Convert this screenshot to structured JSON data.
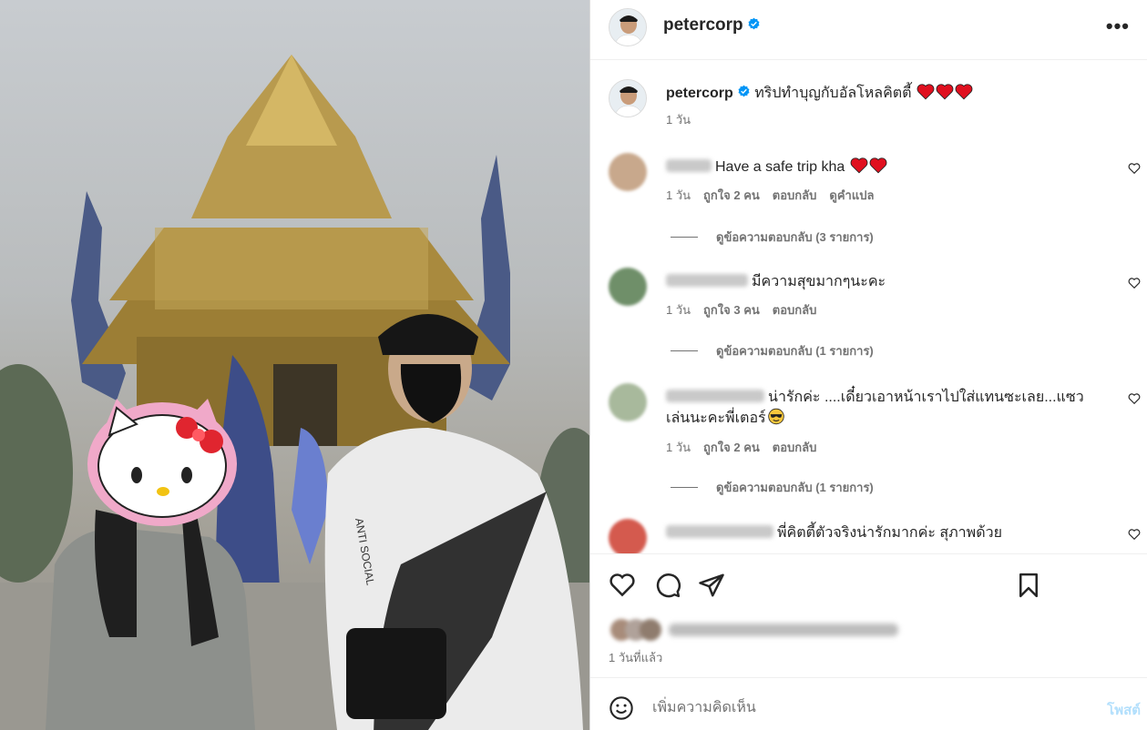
{
  "post": {
    "username": "petercorp",
    "caption_username": "petercorp",
    "caption_text": "ทริปทำบุญกับอัลโหลคิตตี้",
    "caption_time": "1 วัน",
    "timestamp": "1 วันที่แล้ว",
    "more_label": "•••"
  },
  "comments": [
    {
      "text": "Have a safe trip kha",
      "emoji": "heart-heart",
      "time": "1 วัน",
      "likes": "ถูกใจ 2 คน",
      "reply": "ตอบกลับ",
      "translate": "ดูคำแปล",
      "view_replies": "ดูข้อความตอบกลับ (3 รายการ)"
    },
    {
      "text": "มีความสุขมากๆนะคะ",
      "time": "1 วัน",
      "likes": "ถูกใจ 3 คน",
      "reply": "ตอบกลับ",
      "view_replies": "ดูข้อความตอบกลับ (1 รายการ)"
    },
    {
      "text_line1": "น่ารักค่ะ ....เดี๋ยวเอาหน้าเราไปใส่แทนซะเลย...แซว",
      "text_line2": "เล่นนะคะพี่เตอร์",
      "emoji": "sunglasses-face",
      "time": "1 วัน",
      "likes": "ถูกใจ 2 คน",
      "reply": "ตอบกลับ",
      "view_replies": "ดูข้อความตอบกลับ (1 รายการ)"
    },
    {
      "text": "พี่คิตตี้ตัวจริงน่ารักมากค่ะ สุภาพด้วย"
    }
  ],
  "actions": {
    "like_icon": "heart-icon",
    "comment_icon": "comment-icon",
    "share_icon": "share-icon",
    "save_icon": "bookmark-icon"
  },
  "add_comment": {
    "placeholder": "เพิ่มความคิดเห็น",
    "post_label": "โพสต์",
    "emoji_icon": "smiley-icon"
  },
  "colors": {
    "text": "#262626",
    "secondary": "#737373",
    "verified": "#0095f6",
    "heart_red": "#e0101f",
    "post_button_disabled": "#b2dffc"
  }
}
